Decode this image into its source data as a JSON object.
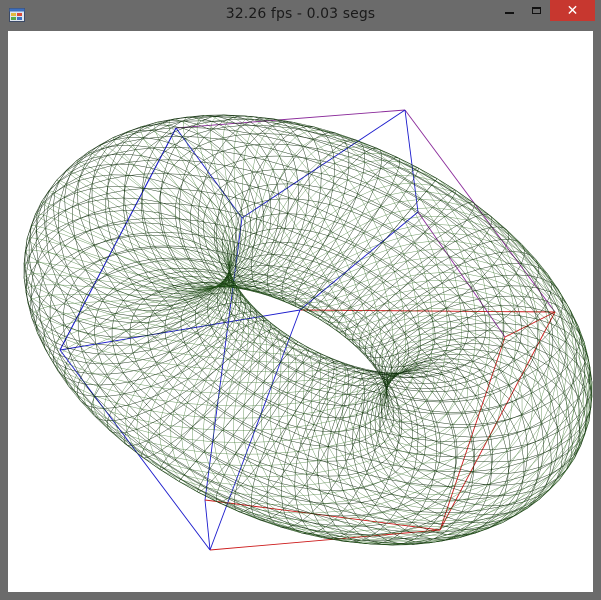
{
  "window": {
    "title": "32.26 fps - 0.03 segs",
    "controls": {
      "minimize_icon": "minimize-icon",
      "maximize_icon": "maximize-icon",
      "close_icon": "close-icon",
      "close_glyph": "✕"
    }
  },
  "scene": {
    "object": "torus-wireframe",
    "colors": {
      "torus_edge": "#0d2a0a",
      "torus_mesh": "#2e6b1f",
      "box_blue": "#1a1acc",
      "box_red": "#cc1a1a",
      "box_purple": "#8a2a9a"
    }
  }
}
